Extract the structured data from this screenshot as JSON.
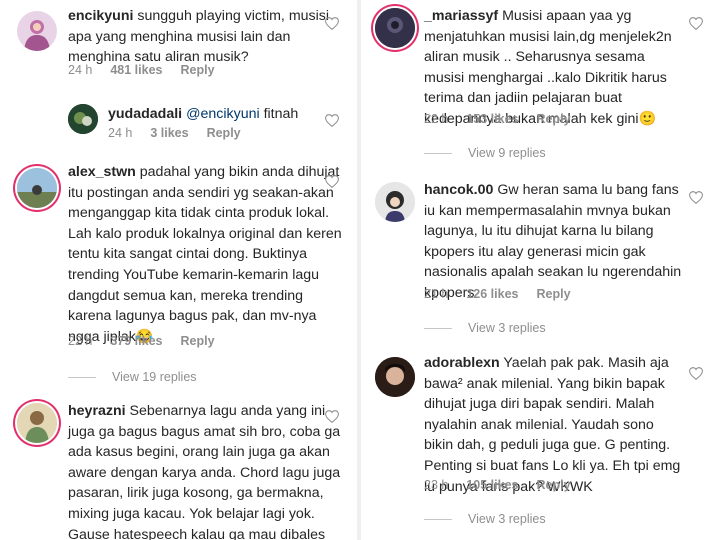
{
  "comments": [
    {
      "user": "encikyuni",
      "text": "sungguh playing victim, musisi apa yang menghina musisi lain dan menghina satu aliran musik?",
      "time": "24 h",
      "likes": "481 likes",
      "reply": "Reply"
    },
    {
      "user": "yudadadali",
      "mention": "@encikyuni",
      "text": " fitnah",
      "time": "24 h",
      "likes": "3 likes",
      "reply": "Reply"
    },
    {
      "user": "alex_stwn",
      "text": "padahal yang bikin anda dihujat itu postingan anda sendiri yg seakan-akan menganggap kita tidak cinta produk lokal. Lah kalo produk lokalnya original dan keren tentu kita sangat cintai dong. Buktinya trending YouTube kemarin-kemarin lagu dangdut semua kan, mereka trending karena lagunya bagus pak, dan mv-nya ngga jiplak😂",
      "time": "22 h",
      "likes": "379 likes",
      "reply": "Reply",
      "view_replies": "View 19 replies"
    },
    {
      "user": "heyrazni",
      "text": "Sebenarnya lagu anda yang ini juga ga bagus bagus amat sih bro, coba ga ada kasus begini, orang lain juga ga akan aware dengan karya anda. Chord lagu juga pasaran, lirik juga kosong, ga  bermakna, mixing juga kacau. Yok belajar lagi yok. Gause hatespeech kalau ga mau dibales hatespeech"
    },
    {
      "user": "_mariassyf",
      "text": "Musisi apaan yaa yg menjatuhkan musisi lain,dg menjelek2n aliran musik .. Seharusnya sesama musisi menghargai ..kalo Dikritik harus terima dan jadiin pelajaran buat kedepannya bukan malah kek gini🙂",
      "time": "22 h",
      "likes": "153 likes",
      "reply": "Reply",
      "view_replies": "View 9 replies"
    },
    {
      "user": "hancok.00",
      "text": "Gw heran sama lu bang fans iu kan mempermasalahin mvnya bukan lagunya, lu itu dihujat karna lu bilang kpopers itu alay generasi micin gak nasionalis apalah seakan lu ngerendahin kpopers",
      "time": "21 h",
      "likes": "126 likes",
      "reply": "Reply",
      "view_replies": "View 3 replies"
    },
    {
      "user": "adorablexn",
      "text": "Yaelah pak pak. Masih aja bawa² anak milenial. Yang bikin bapak dihujat juga diri bapak sendiri. Malah nyalahin anak milenial. Yaudah sono bikin dah, g peduli juga gue. G penting. Penting si buat fans Lo kli ya. Eh tpi emg lu punya fans pak? WKWK",
      "time": "23 h",
      "likes": "105 likes",
      "reply": "Reply",
      "view_replies": "View 3 replies"
    }
  ],
  "colors": {
    "text": "#262626",
    "meta": "#8e8e8e",
    "mention": "#00376b",
    "story_ring": "#e1306c"
  }
}
